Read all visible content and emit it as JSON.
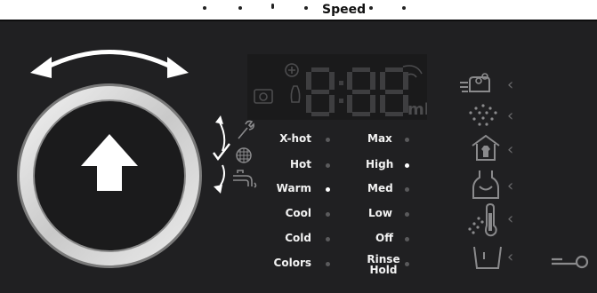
{
  "header": {
    "speed_label": "Speed"
  },
  "display": {
    "time": "8:88",
    "unit": "ml"
  },
  "temperature": {
    "options": [
      "X-hot",
      "Hot",
      "Warm",
      "Cool",
      "Cold",
      "Colors"
    ],
    "selected": "Warm"
  },
  "spin_speed": {
    "options": [
      "Max",
      "High",
      "Med",
      "Low",
      "Off",
      "Rinse Hold"
    ],
    "selected": "High"
  },
  "icons": {
    "left_column": [
      "wrench-icon",
      "grid-icon",
      "faucet-icon"
    ],
    "right_column": [
      "load-detect-icon",
      "spray-icon",
      "shirt-icon",
      "apron-icon",
      "temp-spray-icon",
      "tub-icon"
    ],
    "lock": "key-lock-icon"
  },
  "colors": {
    "panel": "#202022",
    "knob_ring": "#d8d8d8",
    "knob_center": "#1b1b1c",
    "text": "#f2f2f2",
    "indicator_on": "#ffffff",
    "indicator_off": "#5a5a5c"
  }
}
